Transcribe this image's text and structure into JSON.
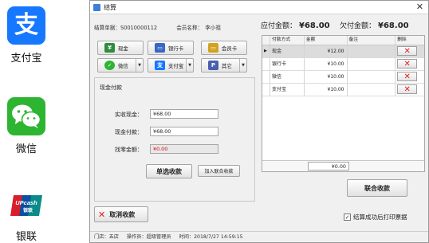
{
  "sidebar": {
    "items": [
      {
        "label": "支付宝",
        "glyph": "支",
        "color": "#1677ff"
      },
      {
        "label": "微信",
        "color": "#2db531"
      },
      {
        "label": "银联",
        "glyph": "UPcash 银联",
        "color": "#d81e2c"
      }
    ]
  },
  "window": {
    "title": "结算",
    "close_label": "✕"
  },
  "info": {
    "order_label": "结算单据：",
    "order_value": "S0010000112",
    "member_label": "会员名称：",
    "member_value": "李小祖"
  },
  "totals": {
    "payable_label": "应付金额：",
    "payable_value": "¥68.00",
    "owed_label": "欠付金额：",
    "owed_value": "¥68.00"
  },
  "pay_buttons": {
    "cash": "现金",
    "bank": "银行卡",
    "member": "会员卡",
    "wechat": "微信",
    "alipay": "支付宝",
    "other": "其它"
  },
  "cash_group": {
    "title": "现金付款",
    "received_label": "实收现金：",
    "received_value": "¥68.00",
    "cash_label": "现金付款：",
    "cash_value": "¥68.00",
    "change_label": "找零金额：",
    "change_value": "¥0.00",
    "single_button": "单选收款",
    "join_button": "加入联合收款"
  },
  "table": {
    "headers": [
      "付款方式",
      "金额",
      "备注",
      "删除"
    ],
    "rows": [
      {
        "method": "现金",
        "amount": "¥12.00",
        "note": ""
      },
      {
        "method": "银行卡",
        "amount": "¥10.00",
        "note": ""
      },
      {
        "method": "微信",
        "amount": "¥10.00",
        "note": ""
      },
      {
        "method": "支付宝",
        "amount": "¥10.00",
        "note": ""
      }
    ],
    "sum_value": "¥0.00"
  },
  "actions": {
    "joint_button": "联合收款",
    "cancel_button": "取消收款",
    "print_checkbox_label": "结算成功后打印票据"
  },
  "footer": {
    "store_label": "门店：",
    "store_value": "五店",
    "operator_label": "操作员：",
    "operator_value": "超级管理员",
    "time_label": "时间：",
    "time_value": "2018/7/27 14:59:15"
  }
}
